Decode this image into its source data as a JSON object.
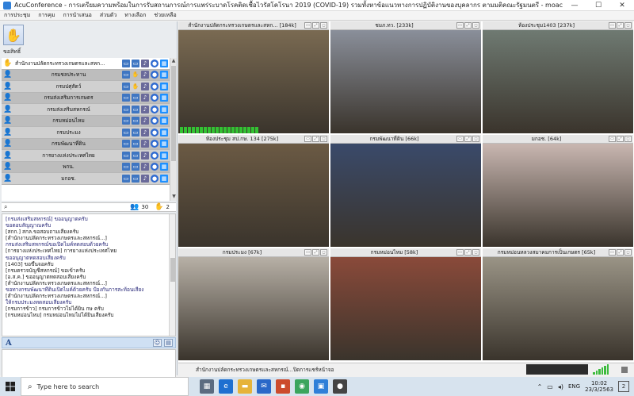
{
  "window": {
    "title": "AcuConference - การเตรียมความพร้อมในการรับสถานการณ์การแพร่ระบาดโรคติดเชื้อไวรัสโคโรนา 2019 (COVID-19) รวมทั้งหาข้อแนวทางการปฏิบัติงานของบุคลากร ตามมติคณะรัฐมนตรี - moacsem",
    "minimize": "—",
    "maximize": "☐",
    "close": "✕"
  },
  "menu": [
    "การประชุม",
    "การคุม",
    "การนำเสนอ",
    "ส่วนตัว",
    "ทางเลือก",
    "ช่วยเหลือ"
  ],
  "hand_button": {
    "label": "ขอสิทธิ์"
  },
  "participants": [
    {
      "name": "สำนักงานปลัดกระทรวงเกษตรและสหก...",
      "icon": "hand",
      "first": true
    },
    {
      "name": "กรมชลประทาน",
      "icon": "user",
      "hand": true
    },
    {
      "name": "กรมปศุสัตว์",
      "icon": "user",
      "hand": true
    },
    {
      "name": "กรมส่งเสริมการเกษตร",
      "icon": "user",
      "hand": false
    },
    {
      "name": "กรมส่งเสริมสหกรณ์",
      "icon": "user",
      "hand": false
    },
    {
      "name": "กรมหม่อนไหม",
      "icon": "user",
      "hand": false
    },
    {
      "name": "กรมประมง",
      "icon": "user",
      "hand": false
    },
    {
      "name": "กรมพัฒนาที่ดิน",
      "icon": "user",
      "hand": false
    },
    {
      "name": "การยางแห่งประเทศไทย",
      "icon": "user",
      "hand": false
    },
    {
      "name": "พกน.",
      "icon": "user",
      "hand": false
    },
    {
      "name": "มกอช.",
      "icon": "user",
      "hand": false
    }
  ],
  "counts": {
    "participants": "30",
    "hands": "2"
  },
  "chat_lines": [
    {
      "text": "[กรมส่งเสริมสหกรณ์] ขออนุญาตครับ",
      "sender": false
    },
    {
      "text": "ขอตอบสัญญาณครับ",
      "sender": false
    },
    {
      "text": "[สกก.] สกล.ขอสอบถามเสียงครับ",
      "sender": true
    },
    {
      "text": "[สำนักงานปลัดกระทรวงเกษตรและสหกรณ์...]",
      "sender": true
    },
    {
      "text": "กรมส่งเสริมสหกรณ์ขอเปิดไมค์ทดสอบด้วยครับ",
      "sender": false
    },
    {
      "text": "[การยางแห่งประเทศไทย] การยางแห่งประเทศไทย",
      "sender": true
    },
    {
      "text": "ขออนุญาตทดสอบเสียงครับ",
      "sender": false
    },
    {
      "text": "[1403] ขอขึ้นจอครับ",
      "sender": true
    },
    {
      "text": "[กรมตรวจบัญชีสหกรณ์] ขอเข้าครับ",
      "sender": true
    },
    {
      "text": "[อ.ส.ค.] ขออนุญาตทดสอบเสียงครับ",
      "sender": true
    },
    {
      "text": "[สำนักงานปลัดกระทรวงเกษตรและสหกรณ์...]",
      "sender": true
    },
    {
      "text": "ขอทางกรมพัฒนาที่ดินเปิดไมค์ด้วยครับ ป้องกันการสะท้อนเสียง",
      "sender": false
    },
    {
      "text": "[สำนักงานปลัดกระทรวงเกษตรและสหกรณ์...]",
      "sender": true
    },
    {
      "text": "ให้กรมประมงทดสอบเสียงครับ",
      "sender": false
    },
    {
      "text": "[กรมการข้าว] กรมการข้าวไม่ได้ยิน กษ ครับ",
      "sender": true
    },
    {
      "text": "[กรมหม่อนไหม] กรมหม่อนไหมไม่ได้ยินเสียงครับ",
      "sender": true
    }
  ],
  "chat_tools": {
    "font": "A"
  },
  "tiles": [
    {
      "name": "สำนักงานปลัดกระทรวงเกษตรและสหก... [184k]",
      "bg": "#7a6a52",
      "meter": true
    },
    {
      "name": "ชมภ.ทว. [233k]",
      "bg": "#8a8f9a",
      "meter": false
    },
    {
      "name": "ห้องประชุม1403 [237k]",
      "bg": "#6f7a72",
      "meter": false
    },
    {
      "name": "ห้องประชุม สป.กษ. 134 [275k]",
      "bg": "#6b5a44",
      "meter": false
    },
    {
      "name": "กรมพัฒนาที่ดิน [66k]",
      "bg": "#3a4a6a",
      "meter": false
    },
    {
      "name": "มกอช. [64k]",
      "bg": "#c9b7b1",
      "meter": false
    },
    {
      "name": "กรมประมง [67k]",
      "bg": "#b7b0a6",
      "meter": false
    },
    {
      "name": "กรมหม่อนไหม [58k]",
      "bg": "#8a4a3a",
      "meter": false
    },
    {
      "name": "กรมหม่อนหลวงสมาคมการเป็นเกษตร [65k]",
      "bg": "#9a9486",
      "meter": false
    }
  ],
  "status_line": {
    "text": "สำนักงานปลัดกระทรวงเกษตรและสหกรณ์...ปิดการแชร์หน้าจอ"
  },
  "taskbar": {
    "search_placeholder": "Type here to search",
    "language": "ENG",
    "time": "10:02",
    "date": "23/3/2563",
    "notification": "2"
  },
  "colors": {
    "accent": "#2f7fd8",
    "participant_row": "#bdbdbd",
    "audio_green": "#33c233"
  },
  "icons": {
    "hand": "raise-hand-icon",
    "user": "user-icon",
    "search": "search-icon",
    "people": "people-icon",
    "windows": "windows-logo-icon"
  }
}
